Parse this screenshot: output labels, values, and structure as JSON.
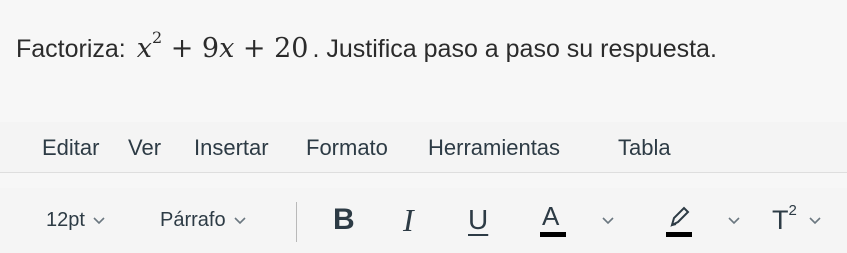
{
  "question": {
    "prefix": "Factoriza:",
    "math": {
      "var1": "x",
      "exp": "2",
      "op1": " + 9",
      "var2": "x",
      "op2": " + 20"
    },
    "suffix": ". Justifica paso a paso su respuesta."
  },
  "menubar": {
    "items": [
      "Editar",
      "Ver",
      "Insertar",
      "Formato",
      "Herramientas",
      "Tabla"
    ]
  },
  "toolbar": {
    "font_size": "12pt",
    "block_format": "Párrafo",
    "bold_icon": "B",
    "italic_icon": "I",
    "underline_icon": "U",
    "text_color_icon": "A",
    "superscript_icon": "T",
    "superscript_exp": "2",
    "colors": {
      "text_color_bar": "#000000",
      "highlight_bar": "#000000"
    }
  },
  "icons": {
    "chevron": "chevron-down-icon",
    "highlight": "highlighter-icon"
  }
}
